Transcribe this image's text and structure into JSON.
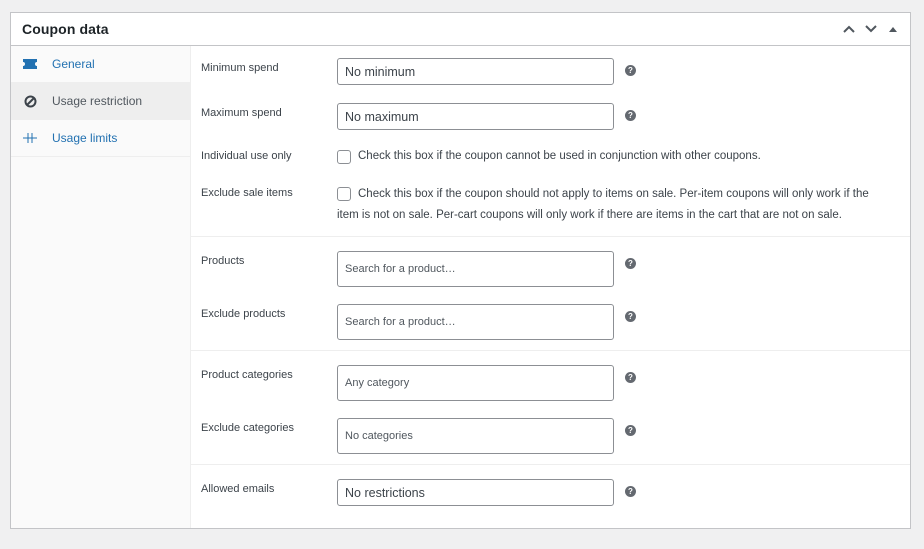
{
  "header": {
    "title": "Coupon data",
    "actions": [
      {
        "name": "move-up-button",
        "icon": "chevron-up-icon"
      },
      {
        "name": "move-down-button",
        "icon": "chevron-down-icon"
      },
      {
        "name": "toggle-panel-button",
        "icon": "triangle-up-icon"
      }
    ]
  },
  "tabs": [
    {
      "label": "General",
      "icon": "ticket-icon",
      "active": false
    },
    {
      "label": "Usage restriction",
      "icon": "block-icon",
      "active": true
    },
    {
      "label": "Usage limits",
      "icon": "limits-icon",
      "active": false
    }
  ],
  "fields": {
    "minimum_spend": {
      "label": "Minimum spend",
      "placeholder": "No minimum"
    },
    "maximum_spend": {
      "label": "Maximum spend",
      "placeholder": "No maximum"
    },
    "individual_use": {
      "label": "Individual use only",
      "description": "Check this box if the coupon cannot be used in conjunction with other coupons.",
      "checked": false
    },
    "exclude_sale_items": {
      "label": "Exclude sale items",
      "description_line1": "Check this box if the coupon should not apply to items on sale. Per-item coupons will only work if the",
      "description_line2": "item is not on sale. Per-cart coupons will only work if there are items in the cart that are not on sale.",
      "checked": false
    },
    "products": {
      "label": "Products",
      "placeholder": "Search for a product…"
    },
    "exclude_products": {
      "label": "Exclude products",
      "placeholder": "Search for a product…"
    },
    "product_categories": {
      "label": "Product categories",
      "placeholder": "Any category"
    },
    "exclude_categories": {
      "label": "Exclude categories",
      "placeholder": "No categories"
    },
    "allowed_emails": {
      "label": "Allowed emails",
      "placeholder": "No restrictions"
    }
  },
  "help_icon": "?",
  "colors": {
    "link": "#2271b1",
    "active_tab_bg": "#eeeeee",
    "border": "#c3c4c7"
  }
}
